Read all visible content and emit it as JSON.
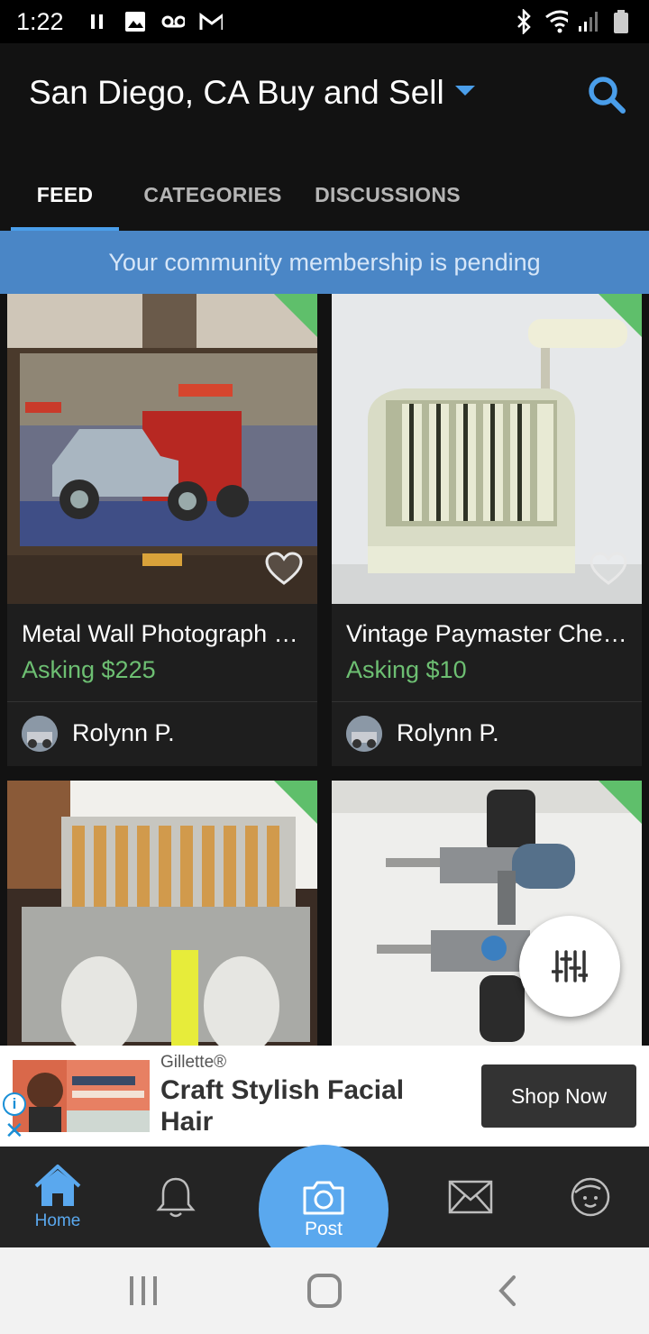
{
  "status_bar": {
    "time": "1:22",
    "left_icons": [
      "pause-icon",
      "image-icon",
      "voicemail-icon",
      "gmail-icon"
    ],
    "right_icons": [
      "bluetooth-icon",
      "wifi-icon",
      "signal-icon",
      "battery-icon"
    ]
  },
  "header": {
    "title": "San Diego, CA Buy and Sell",
    "accent_color": "#4a9eea"
  },
  "tabs": [
    {
      "label": "FEED",
      "active": true
    },
    {
      "label": "CATEGORIES",
      "active": false
    },
    {
      "label": "DISCUSSIONS",
      "active": false
    }
  ],
  "banner": {
    "text": "Your community membership is pending",
    "color": "#4a86c6"
  },
  "listings": [
    {
      "title": "Metal Wall Photograph …",
      "price": "Asking $225",
      "seller": "Rolynn P."
    },
    {
      "title": "Vintage Paymaster Che…",
      "price": "Asking $10",
      "seller": "Rolynn P."
    },
    {
      "title": "",
      "price": "",
      "seller": ""
    },
    {
      "title": "",
      "price": "",
      "seller": ""
    }
  ],
  "ad": {
    "brand": "Gillette®",
    "headline": "Craft Stylish Facial Hair",
    "cta": "Shop Now"
  },
  "bottom_nav": {
    "home": "Home",
    "post": "Post",
    "items": [
      "home-icon",
      "bell-icon",
      "camera-icon",
      "mail-icon",
      "profile-icon"
    ]
  }
}
